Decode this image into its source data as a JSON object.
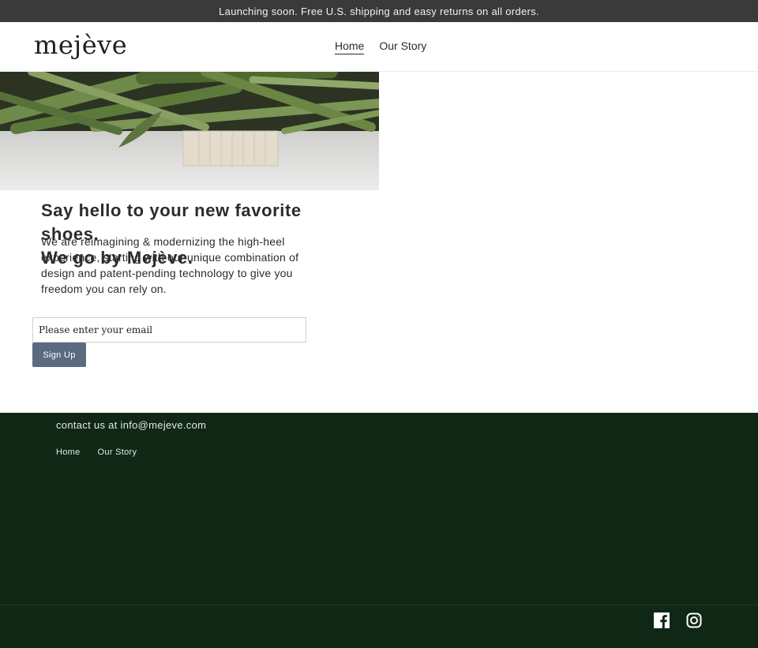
{
  "announcement": "Launching soon. Free U.S. shipping and easy returns on all orders.",
  "header": {
    "logo": "mejève",
    "nav": [
      {
        "label": "Home",
        "active": true
      },
      {
        "label": "Our Story",
        "active": false
      }
    ]
  },
  "main": {
    "headline_line1": "Say hello to your new favorite shoes.",
    "headline_line2": "We go by Mejève.",
    "body": "We are reimagining & modernizing the high-heel experience, starting with our unique combination of design and patent-pending technology to give you freedom you can rely on.",
    "signup": {
      "placeholder": "Please enter your email",
      "value": "",
      "button_label": "Sign Up"
    }
  },
  "footer": {
    "contact": "contact us at info@mejeve.com",
    "links": [
      "Home",
      "Our Story"
    ],
    "social_icons": [
      "facebook-icon",
      "instagram-icon"
    ]
  },
  "colors": {
    "announcement_bg": "#3a3a3a",
    "footer_bg": "#0f2714",
    "button_bg": "#5c6a80"
  }
}
